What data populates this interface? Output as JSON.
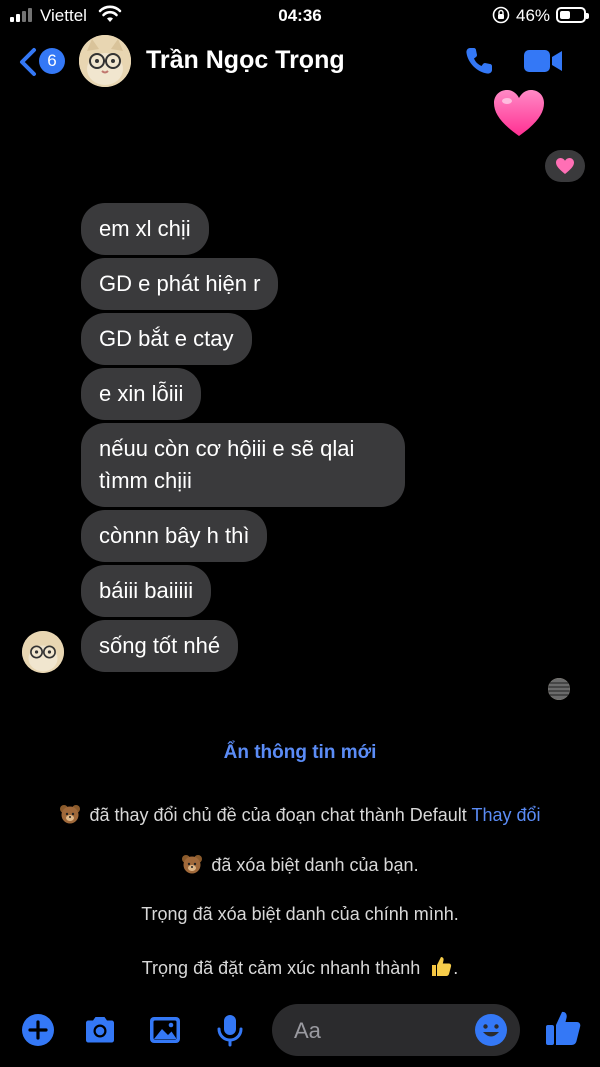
{
  "status_bar": {
    "carrier": "Viettel",
    "time": "04:36",
    "battery_percent": "46%",
    "battery_level": 0.46
  },
  "header": {
    "back_count": "6",
    "contact_name": "Trần Ngọc Trọng",
    "icons": [
      "back-chevron-icon",
      "phone-icon",
      "video-camera-icon"
    ]
  },
  "messages": [
    {
      "text": "em xl chịi"
    },
    {
      "text": "GD e phát hiện r"
    },
    {
      "text": "GD bắt e ctay"
    },
    {
      "text": "e xin lỗiii"
    },
    {
      "text": "nếuu còn cơ hộiii e sẽ qlai tìmm chịii"
    },
    {
      "text": "cònnn bây h thì"
    },
    {
      "text": "báiii baiiiii"
    },
    {
      "text": "sống tốt nhé"
    }
  ],
  "notices": {
    "hide_info": "Ẩn thông tin mới",
    "theme_changed": "đã thay đổi chủ đề của đoạn chat thành Default",
    "theme_change_link": "Thay đổi",
    "nickname_removed_yours": "đã xóa biệt danh của bạn.",
    "nickname_removed_own": "Trọng đã xóa biệt danh của chính mình.",
    "quick_reaction": "Trọng đã đặt cảm xúc nhanh thành"
  },
  "composer": {
    "placeholder": "Aa",
    "icons": [
      "plus-icon",
      "camera-icon",
      "image-icon",
      "microphone-icon",
      "emoji-icon",
      "thumbs-up-icon"
    ]
  },
  "colors": {
    "accent": "#3478f6",
    "bubble": "#3a3a3c",
    "background": "#000000",
    "heart": "#ff4fa3"
  }
}
